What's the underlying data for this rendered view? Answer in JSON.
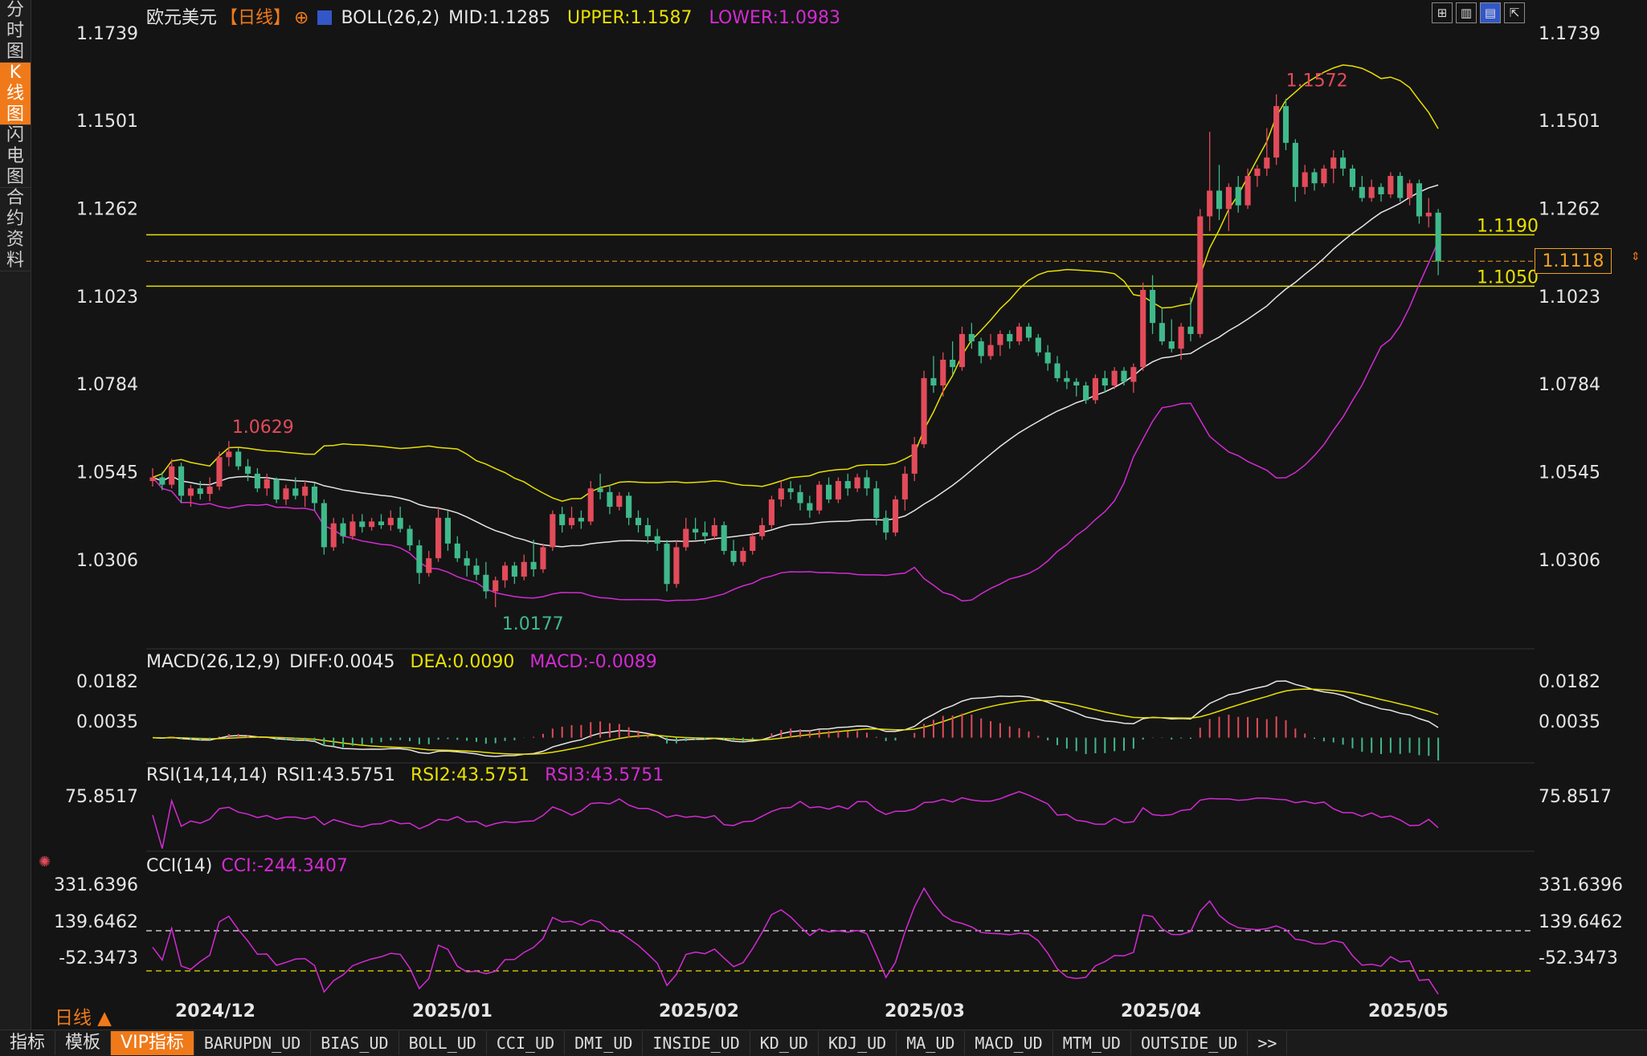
{
  "sidebar_tabs": [
    {
      "label": "分时图"
    },
    {
      "label": "K线图",
      "active": true
    },
    {
      "label": "闪电图"
    },
    {
      "label": "合约资料"
    }
  ],
  "main_header": {
    "symbol": "欧元美元",
    "period_tag": "【日线】",
    "boll_label": "BOLL(26,2)",
    "mid": "MID:1.1285",
    "upper": "UPPER:1.1587",
    "lower": "LOWER:1.0983"
  },
  "toolbar_icons": [
    "grid-icon",
    "chart-icon",
    "chart-active-icon",
    "export-icon"
  ],
  "price_axis": [
    "1.1739",
    "1.1501",
    "1.1262",
    "1.1023",
    "1.0784",
    "1.0545",
    "1.0306"
  ],
  "price_lines": {
    "upper_label": "1.1190",
    "lower_label": "1.1050",
    "current_price": "1.1118"
  },
  "annotations": {
    "high": "1.1572",
    "mid_high": "1.0629",
    "low": "1.0177"
  },
  "macd_header": {
    "label": "MACD(26,12,9)",
    "diff": "DIFF:0.0045",
    "dea": "DEA:0.0090",
    "macd": "MACD:-0.0089"
  },
  "macd_axis": [
    "0.0182",
    "0.0035"
  ],
  "rsi_header": {
    "label": "RSI(14,14,14)",
    "rsi1": "RSI1:43.5751",
    "rsi2": "RSI2:43.5751",
    "rsi3": "RSI3:43.5751"
  },
  "rsi_axis": [
    "75.8517"
  ],
  "cci_header": {
    "label": "CCI(14)",
    "cci": "CCI:-244.3407"
  },
  "cci_axis": [
    "331.6396",
    "139.6462",
    "-52.3473"
  ],
  "date_axis": [
    "2024/12",
    "2025/01",
    "2025/02",
    "2025/03",
    "2025/04",
    "2025/05"
  ],
  "period_label": "日线 ▲",
  "bottom_tabs": [
    "指标",
    "模板",
    "VIP指标",
    "BARUPDN_UD",
    "BIAS_UD",
    "BOLL_UD",
    "CCI_UD",
    "DMI_UD",
    "INSIDE_UD",
    "KD_UD",
    "KDJ_UD",
    "MA_UD",
    "MACD_UD",
    "MTM_UD",
    "OUTSIDE_UD",
    ">>"
  ],
  "active_bottom_tab": "VIP指标",
  "colors": {
    "up": "#e24b5a",
    "down": "#3fb98b",
    "mid": "#e6e6e6",
    "upper": "#e8e000",
    "lower": "#d42ad4",
    "accent": "#f07a1a",
    "axis_text": "#e6e6e6",
    "red_text": "#e24b5a",
    "green_text": "#3fb98b"
  },
  "chart_data": {
    "type": "candlestick",
    "price_range": [
      1.01,
      1.18
    ],
    "candles": [
      [
        1.052,
        1.0555,
        1.0505,
        1.053
      ],
      [
        1.053,
        1.0545,
        1.0495,
        1.051
      ],
      [
        1.051,
        1.058,
        1.05,
        1.056
      ],
      [
        1.056,
        1.057,
        1.046,
        1.048
      ],
      [
        1.048,
        1.051,
        1.045,
        1.05
      ],
      [
        1.05,
        1.052,
        1.047,
        1.0485
      ],
      [
        1.0485,
        1.053,
        1.0465,
        1.0505
      ],
      [
        1.0505,
        1.06,
        1.0495,
        1.0585
      ],
      [
        1.0585,
        1.0629,
        1.056,
        1.06
      ],
      [
        1.06,
        1.061,
        1.055,
        1.056
      ],
      [
        1.056,
        1.058,
        1.052,
        1.054
      ],
      [
        1.054,
        1.0555,
        1.049,
        1.05
      ],
      [
        1.05,
        1.054,
        1.048,
        1.0525
      ],
      [
        1.0525,
        1.053,
        1.046,
        1.047
      ],
      [
        1.047,
        1.051,
        1.0455,
        1.05
      ],
      [
        1.05,
        1.053,
        1.047,
        1.048
      ],
      [
        1.048,
        1.052,
        1.045,
        1.0505
      ],
      [
        1.0505,
        1.0515,
        1.044,
        1.046
      ],
      [
        1.046,
        1.047,
        1.032,
        1.034
      ],
      [
        1.034,
        1.042,
        1.033,
        1.0405
      ],
      [
        1.0405,
        1.042,
        1.035,
        1.037
      ],
      [
        1.037,
        1.043,
        1.036,
        1.041
      ],
      [
        1.041,
        1.043,
        1.038,
        1.0395
      ],
      [
        1.0395,
        1.042,
        1.0385,
        1.041
      ],
      [
        1.041,
        1.043,
        1.039,
        1.04
      ],
      [
        1.04,
        1.044,
        1.0385,
        1.042
      ],
      [
        1.042,
        1.045,
        1.038,
        1.039
      ],
      [
        1.039,
        1.04,
        1.033,
        1.0345
      ],
      [
        1.0345,
        1.036,
        1.024,
        1.027
      ],
      [
        1.027,
        1.033,
        1.026,
        1.031
      ],
      [
        1.031,
        1.045,
        1.03,
        1.042
      ],
      [
        1.042,
        1.044,
        1.033,
        1.035
      ],
      [
        1.035,
        1.037,
        1.03,
        1.031
      ],
      [
        1.031,
        1.033,
        1.026,
        1.029
      ],
      [
        1.029,
        1.031,
        1.025,
        1.0265
      ],
      [
        1.0265,
        1.03,
        1.02,
        1.022
      ],
      [
        1.022,
        1.026,
        1.0177,
        1.025
      ],
      [
        1.025,
        1.03,
        1.023,
        1.029
      ],
      [
        1.029,
        1.03,
        1.024,
        1.026
      ],
      [
        1.026,
        1.032,
        1.025,
        1.03
      ],
      [
        1.03,
        1.036,
        1.026,
        1.028
      ],
      [
        1.028,
        1.035,
        1.027,
        1.034
      ],
      [
        1.034,
        1.044,
        1.033,
        1.043
      ],
      [
        1.043,
        1.045,
        1.038,
        1.04
      ],
      [
        1.04,
        1.045,
        1.039,
        1.042
      ],
      [
        1.042,
        1.044,
        1.039,
        1.041
      ],
      [
        1.041,
        1.052,
        1.04,
        1.05
      ],
      [
        1.05,
        1.054,
        1.047,
        1.049
      ],
      [
        1.049,
        1.051,
        1.043,
        1.045
      ],
      [
        1.045,
        1.049,
        1.044,
        1.048
      ],
      [
        1.048,
        1.049,
        1.04,
        1.042
      ],
      [
        1.042,
        1.044,
        1.038,
        1.04
      ],
      [
        1.04,
        1.042,
        1.035,
        1.037
      ],
      [
        1.037,
        1.039,
        1.033,
        1.035
      ],
      [
        1.035,
        1.036,
        1.022,
        1.024
      ],
      [
        1.024,
        1.036,
        1.023,
        1.034
      ],
      [
        1.034,
        1.042,
        1.033,
        1.039
      ],
      [
        1.039,
        1.042,
        1.036,
        1.038
      ],
      [
        1.038,
        1.041,
        1.035,
        1.037
      ],
      [
        1.037,
        1.042,
        1.036,
        1.04
      ],
      [
        1.04,
        1.041,
        1.032,
        1.033
      ],
      [
        1.033,
        1.036,
        1.029,
        1.03
      ],
      [
        1.03,
        1.034,
        1.029,
        1.033
      ],
      [
        1.033,
        1.038,
        1.032,
        1.037
      ],
      [
        1.037,
        1.042,
        1.036,
        1.04
      ],
      [
        1.04,
        1.048,
        1.039,
        1.047
      ],
      [
        1.047,
        1.052,
        1.045,
        1.05
      ],
      [
        1.05,
        1.052,
        1.047,
        1.049
      ],
      [
        1.049,
        1.051,
        1.044,
        1.046
      ],
      [
        1.046,
        1.048,
        1.042,
        1.044
      ],
      [
        1.044,
        1.052,
        1.043,
        1.051
      ],
      [
        1.051,
        1.053,
        1.046,
        1.047
      ],
      [
        1.047,
        1.053,
        1.046,
        1.052
      ],
      [
        1.052,
        1.054,
        1.048,
        1.05
      ],
      [
        1.05,
        1.054,
        1.049,
        1.053
      ],
      [
        1.053,
        1.055,
        1.048,
        1.05
      ],
      [
        1.05,
        1.052,
        1.04,
        1.042
      ],
      [
        1.042,
        1.044,
        1.036,
        1.038
      ],
      [
        1.038,
        1.048,
        1.037,
        1.047
      ],
      [
        1.047,
        1.056,
        1.044,
        1.054
      ],
      [
        1.054,
        1.064,
        1.052,
        1.062
      ],
      [
        1.062,
        1.082,
        1.061,
        1.08
      ],
      [
        1.08,
        1.086,
        1.076,
        1.078
      ],
      [
        1.078,
        1.087,
        1.075,
        1.085
      ],
      [
        1.085,
        1.09,
        1.081,
        1.083
      ],
      [
        1.083,
        1.094,
        1.082,
        1.092
      ],
      [
        1.092,
        1.095,
        1.088,
        1.09
      ],
      [
        1.09,
        1.091,
        1.084,
        1.086
      ],
      [
        1.086,
        1.092,
        1.085,
        1.089
      ],
      [
        1.089,
        1.093,
        1.086,
        1.092
      ],
      [
        1.092,
        1.093,
        1.088,
        1.09
      ],
      [
        1.09,
        1.095,
        1.089,
        1.094
      ],
      [
        1.094,
        1.095,
        1.09,
        1.091
      ],
      [
        1.091,
        1.092,
        1.086,
        1.087
      ],
      [
        1.087,
        1.089,
        1.082,
        1.084
      ],
      [
        1.084,
        1.086,
        1.079,
        1.08
      ],
      [
        1.08,
        1.082,
        1.077,
        1.079
      ],
      [
        1.079,
        1.08,
        1.075,
        1.078
      ],
      [
        1.078,
        1.079,
        1.073,
        1.074
      ],
      [
        1.074,
        1.081,
        1.073,
        1.08
      ],
      [
        1.08,
        1.082,
        1.076,
        1.078
      ],
      [
        1.078,
        1.083,
        1.077,
        1.082
      ],
      [
        1.082,
        1.083,
        1.078,
        1.079
      ],
      [
        1.079,
        1.084,
        1.076,
        1.083
      ],
      [
        1.083,
        1.106,
        1.082,
        1.104
      ],
      [
        1.104,
        1.108,
        1.092,
        1.095
      ],
      [
        1.095,
        1.099,
        1.089,
        1.09
      ],
      [
        1.09,
        1.096,
        1.087,
        1.088
      ],
      [
        1.088,
        1.095,
        1.085,
        1.094
      ],
      [
        1.094,
        1.102,
        1.09,
        1.092
      ],
      [
        1.092,
        1.126,
        1.091,
        1.124
      ],
      [
        1.124,
        1.147,
        1.12,
        1.131
      ],
      [
        1.131,
        1.138,
        1.123,
        1.126
      ],
      [
        1.126,
        1.133,
        1.12,
        1.132
      ],
      [
        1.132,
        1.135,
        1.125,
        1.127
      ],
      [
        1.127,
        1.137,
        1.126,
        1.135
      ],
      [
        1.135,
        1.138,
        1.132,
        1.137
      ],
      [
        1.137,
        1.148,
        1.135,
        1.14
      ],
      [
        1.14,
        1.1572,
        1.138,
        1.154
      ],
      [
        1.154,
        1.156,
        1.142,
        1.144
      ],
      [
        1.144,
        1.145,
        1.128,
        1.132
      ],
      [
        1.132,
        1.138,
        1.13,
        1.136
      ],
      [
        1.136,
        1.137,
        1.131,
        1.133
      ],
      [
        1.133,
        1.138,
        1.132,
        1.137
      ],
      [
        1.137,
        1.142,
        1.133,
        1.14
      ],
      [
        1.14,
        1.142,
        1.135,
        1.137
      ],
      [
        1.137,
        1.138,
        1.131,
        1.132
      ],
      [
        1.132,
        1.135,
        1.128,
        1.129
      ],
      [
        1.129,
        1.134,
        1.128,
        1.132
      ],
      [
        1.132,
        1.133,
        1.128,
        1.13
      ],
      [
        1.13,
        1.136,
        1.129,
        1.135
      ],
      [
        1.135,
        1.136,
        1.128,
        1.129
      ],
      [
        1.129,
        1.134,
        1.127,
        1.133
      ],
      [
        1.133,
        1.134,
        1.122,
        1.124
      ],
      [
        1.124,
        1.129,
        1.121,
        1.125
      ],
      [
        1.125,
        1.126,
        1.108,
        1.1118
      ]
    ]
  }
}
